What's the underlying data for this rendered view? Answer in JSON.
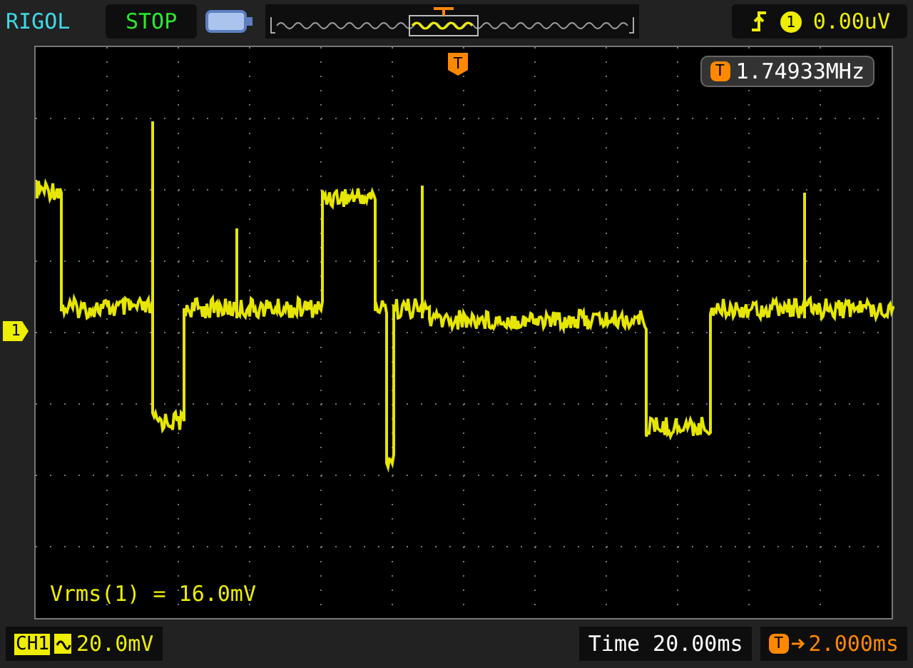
{
  "top_bar": {
    "brand": "RIGOL",
    "run_state": "STOP",
    "trigger": {
      "source": "1",
      "level": "0.00uV"
    }
  },
  "screen": {
    "trigger_position_marker": "T",
    "channel_marker": "1",
    "frequency": {
      "badge": "T",
      "value": "1.74933MHz"
    },
    "measurement": "Vrms(1) = 16.0mV"
  },
  "bottom_bar": {
    "channel": "CH1",
    "scale": "20.0mV",
    "timebase": "Time 20.00ms",
    "trigger_offset": {
      "badge": "T",
      "value": "2.000ms"
    }
  }
}
